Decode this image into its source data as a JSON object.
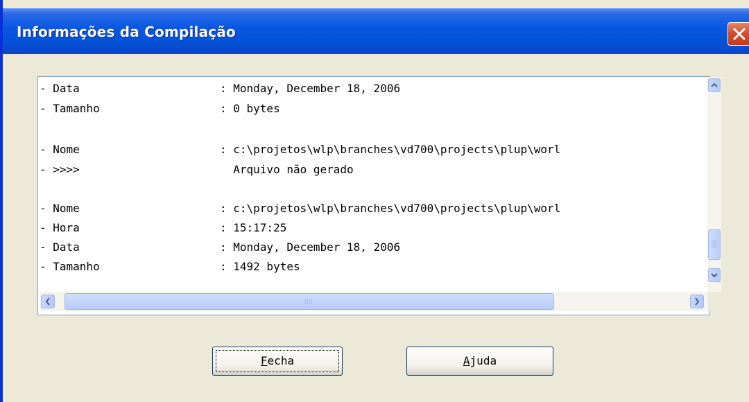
{
  "window": {
    "title": "Informações da Compilação"
  },
  "log_lines": [
    {
      "label": "- Data",
      "value": ": Monday, December 18, 2006"
    },
    {
      "label": "- Tamanho",
      "value": ": 0 bytes"
    },
    {
      "label": "",
      "value": ""
    },
    {
      "label": "- Nome",
      "value": ": c:\\projetos\\wlp\\branches\\vd700\\projects\\plup\\worl"
    },
    {
      "label": "- >>>>",
      "value": "  Arquivo não gerado"
    },
    {
      "label": "",
      "value": ""
    },
    {
      "label": "- Nome",
      "value": ": c:\\projetos\\wlp\\branches\\vd700\\projects\\plup\\worl"
    },
    {
      "label": "- Hora",
      "value": ": 15:17:25"
    },
    {
      "label": "- Data",
      "value": ": Monday, December 18, 2006"
    },
    {
      "label": "- Tamanho",
      "value": ": 1492 bytes"
    }
  ],
  "buttons": {
    "close": {
      "accel": "F",
      "rest": "echa"
    },
    "help": {
      "accel": "A",
      "rest": "juda"
    }
  },
  "icons": {
    "close": "close-x-icon",
    "scroll_up": "arrow-up-icon",
    "scroll_down": "arrow-down-icon",
    "scroll_left": "arrow-left-icon",
    "scroll_right": "arrow-right-icon"
  },
  "colors": {
    "titlebar": "#0a58e3",
    "close_button": "#d3492c",
    "dialog_bg": "#ece9d8",
    "button_border": "#003c74"
  }
}
